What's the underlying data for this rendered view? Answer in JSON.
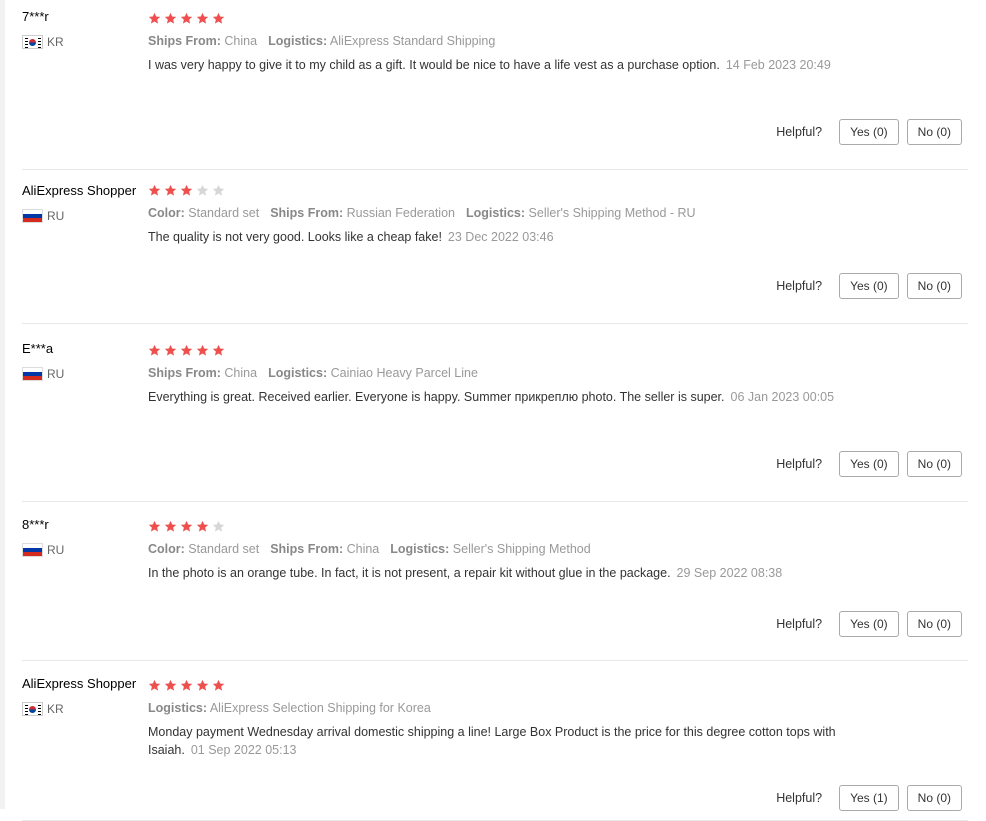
{
  "labels": {
    "ships_from": "Ships From:",
    "logistics": "Logistics:",
    "color": "Color:",
    "helpful": "Helpful?"
  },
  "reviews": [
    {
      "user": "7***r",
      "country": "KR",
      "rating": 5,
      "color": null,
      "ships_from": "China",
      "logistics": "AliExpress Standard Shipping",
      "text": "I was very happy to give it to my child as a gift. It would be nice to have a life vest as a purchase option.",
      "date": "14 Feb 2023 20:49",
      "yes": "Yes (0)",
      "no": "No (0)"
    },
    {
      "user": "AliExpress Shopper",
      "country": "RU",
      "rating": 3,
      "color": "Standard set",
      "ships_from": "Russian Federation",
      "logistics": "Seller's Shipping Method - RU",
      "text": "The quality is not very good. Looks like a cheap fake!",
      "date": "23 Dec 2022 03:46",
      "yes": "Yes (0)",
      "no": "No (0)"
    },
    {
      "user": "E***a",
      "country": "RU",
      "rating": 5,
      "color": null,
      "ships_from": "China",
      "logistics": "Cainiao Heavy Parcel Line",
      "text": "Everything is great. Received earlier. Everyone is happy. Summer прикреплю photo. The seller is super.",
      "date": "06 Jan 2023 00:05",
      "yes": "Yes (0)",
      "no": "No (0)"
    },
    {
      "user": "8***r",
      "country": "RU",
      "rating": 4,
      "color": "Standard set",
      "ships_from": "China",
      "logistics": "Seller's Shipping Method",
      "text": "In the photo is an orange tube. In fact, it is not present, a repair kit without glue in the package.",
      "date": "29 Sep 2022 08:38",
      "yes": "Yes (0)",
      "no": "No (0)"
    },
    {
      "user": "AliExpress Shopper",
      "country": "KR",
      "rating": 5,
      "color": null,
      "ships_from": null,
      "logistics": "AliExpress Selection Shipping for Korea",
      "text": "Monday payment Wednesday arrival domestic shipping a line! Large Box Product is the price for this degree cotton tops with Isaiah.",
      "date": "01 Sep 2022 05:13",
      "yes": "Yes (1)",
      "no": "No (0)"
    }
  ],
  "colors": {
    "star_on": "#f04f4f",
    "star_off": "#d6d6d6"
  },
  "icons": {
    "star": "star-icon",
    "flag_kr": "flag-kr-icon",
    "flag_ru": "flag-ru-icon"
  }
}
